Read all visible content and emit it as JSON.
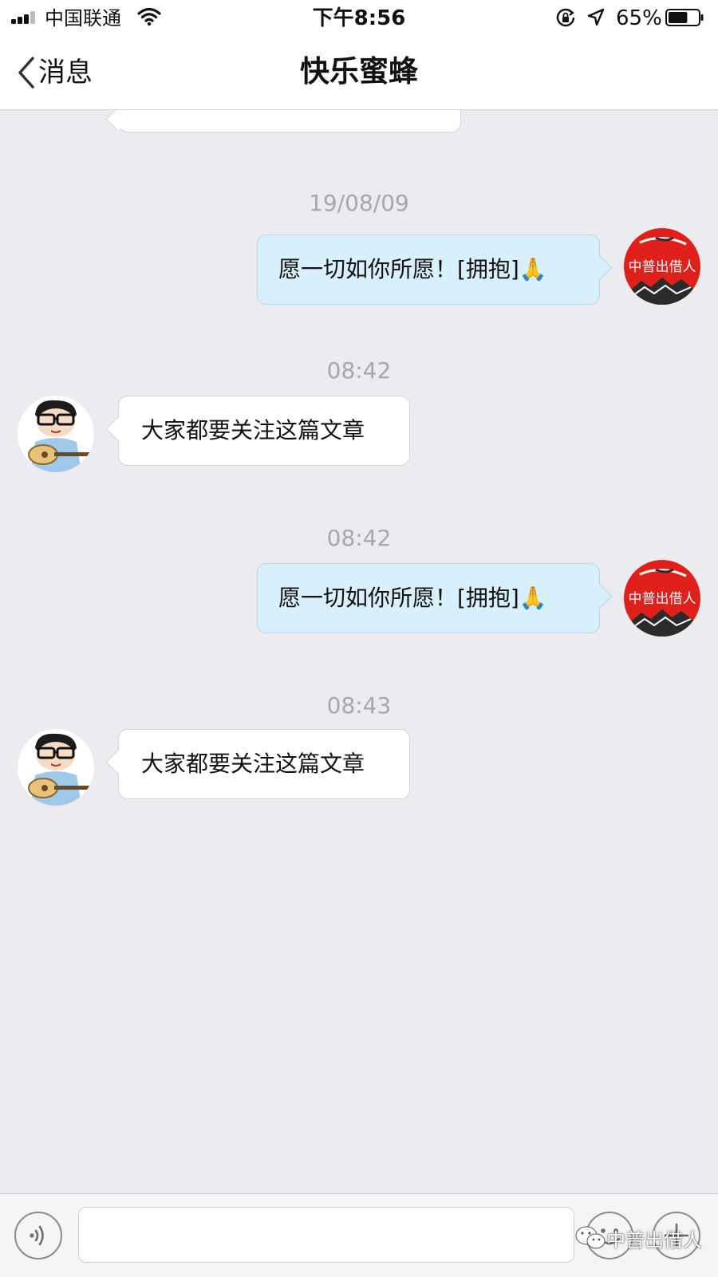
{
  "status_bar": {
    "carrier": "中国联通",
    "time": "下午8:56",
    "battery_percent": "65%",
    "battery_level": 0.65,
    "signal_bars": 3,
    "icons": [
      "signal-icon",
      "wifi-icon",
      "rotation-lock-icon",
      "location-arrow-icon",
      "battery-icon"
    ]
  },
  "nav": {
    "back_label": "消息",
    "title": "快乐蜜蜂"
  },
  "chat": {
    "messages": [
      {
        "direction": "in",
        "text": ""
      },
      {
        "timestamp": "19/08/09",
        "direction": "out",
        "text": "愿一切如你所愿！[拥抱]🙏",
        "avatar": "org-logo-avatar"
      },
      {
        "timestamp": "08:42",
        "direction": "in",
        "text": "大家都要关注这篇文章",
        "avatar": "cartoon-guitar-avatar"
      },
      {
        "timestamp": "08:42",
        "direction": "out",
        "text": "愿一切如你所愿！[拥抱]🙏",
        "avatar": "org-logo-avatar"
      },
      {
        "timestamp": "08:43",
        "direction": "in",
        "text": "大家都要关注这篇文章",
        "avatar": "cartoon-guitar-avatar"
      }
    ]
  },
  "input_bar": {
    "text_value": "",
    "icons": [
      "voice-icon",
      "emoji-icon",
      "plus-icon"
    ]
  },
  "watermark": {
    "text": "中普出借人",
    "icon": "wechat-icon"
  },
  "colors": {
    "background": "#ebebf0",
    "incoming_bubble": "#ffffff",
    "outgoing_bubble": "#d8f0fb",
    "timestamp": "#a6a6ab",
    "logo_red": "#e0201a"
  }
}
